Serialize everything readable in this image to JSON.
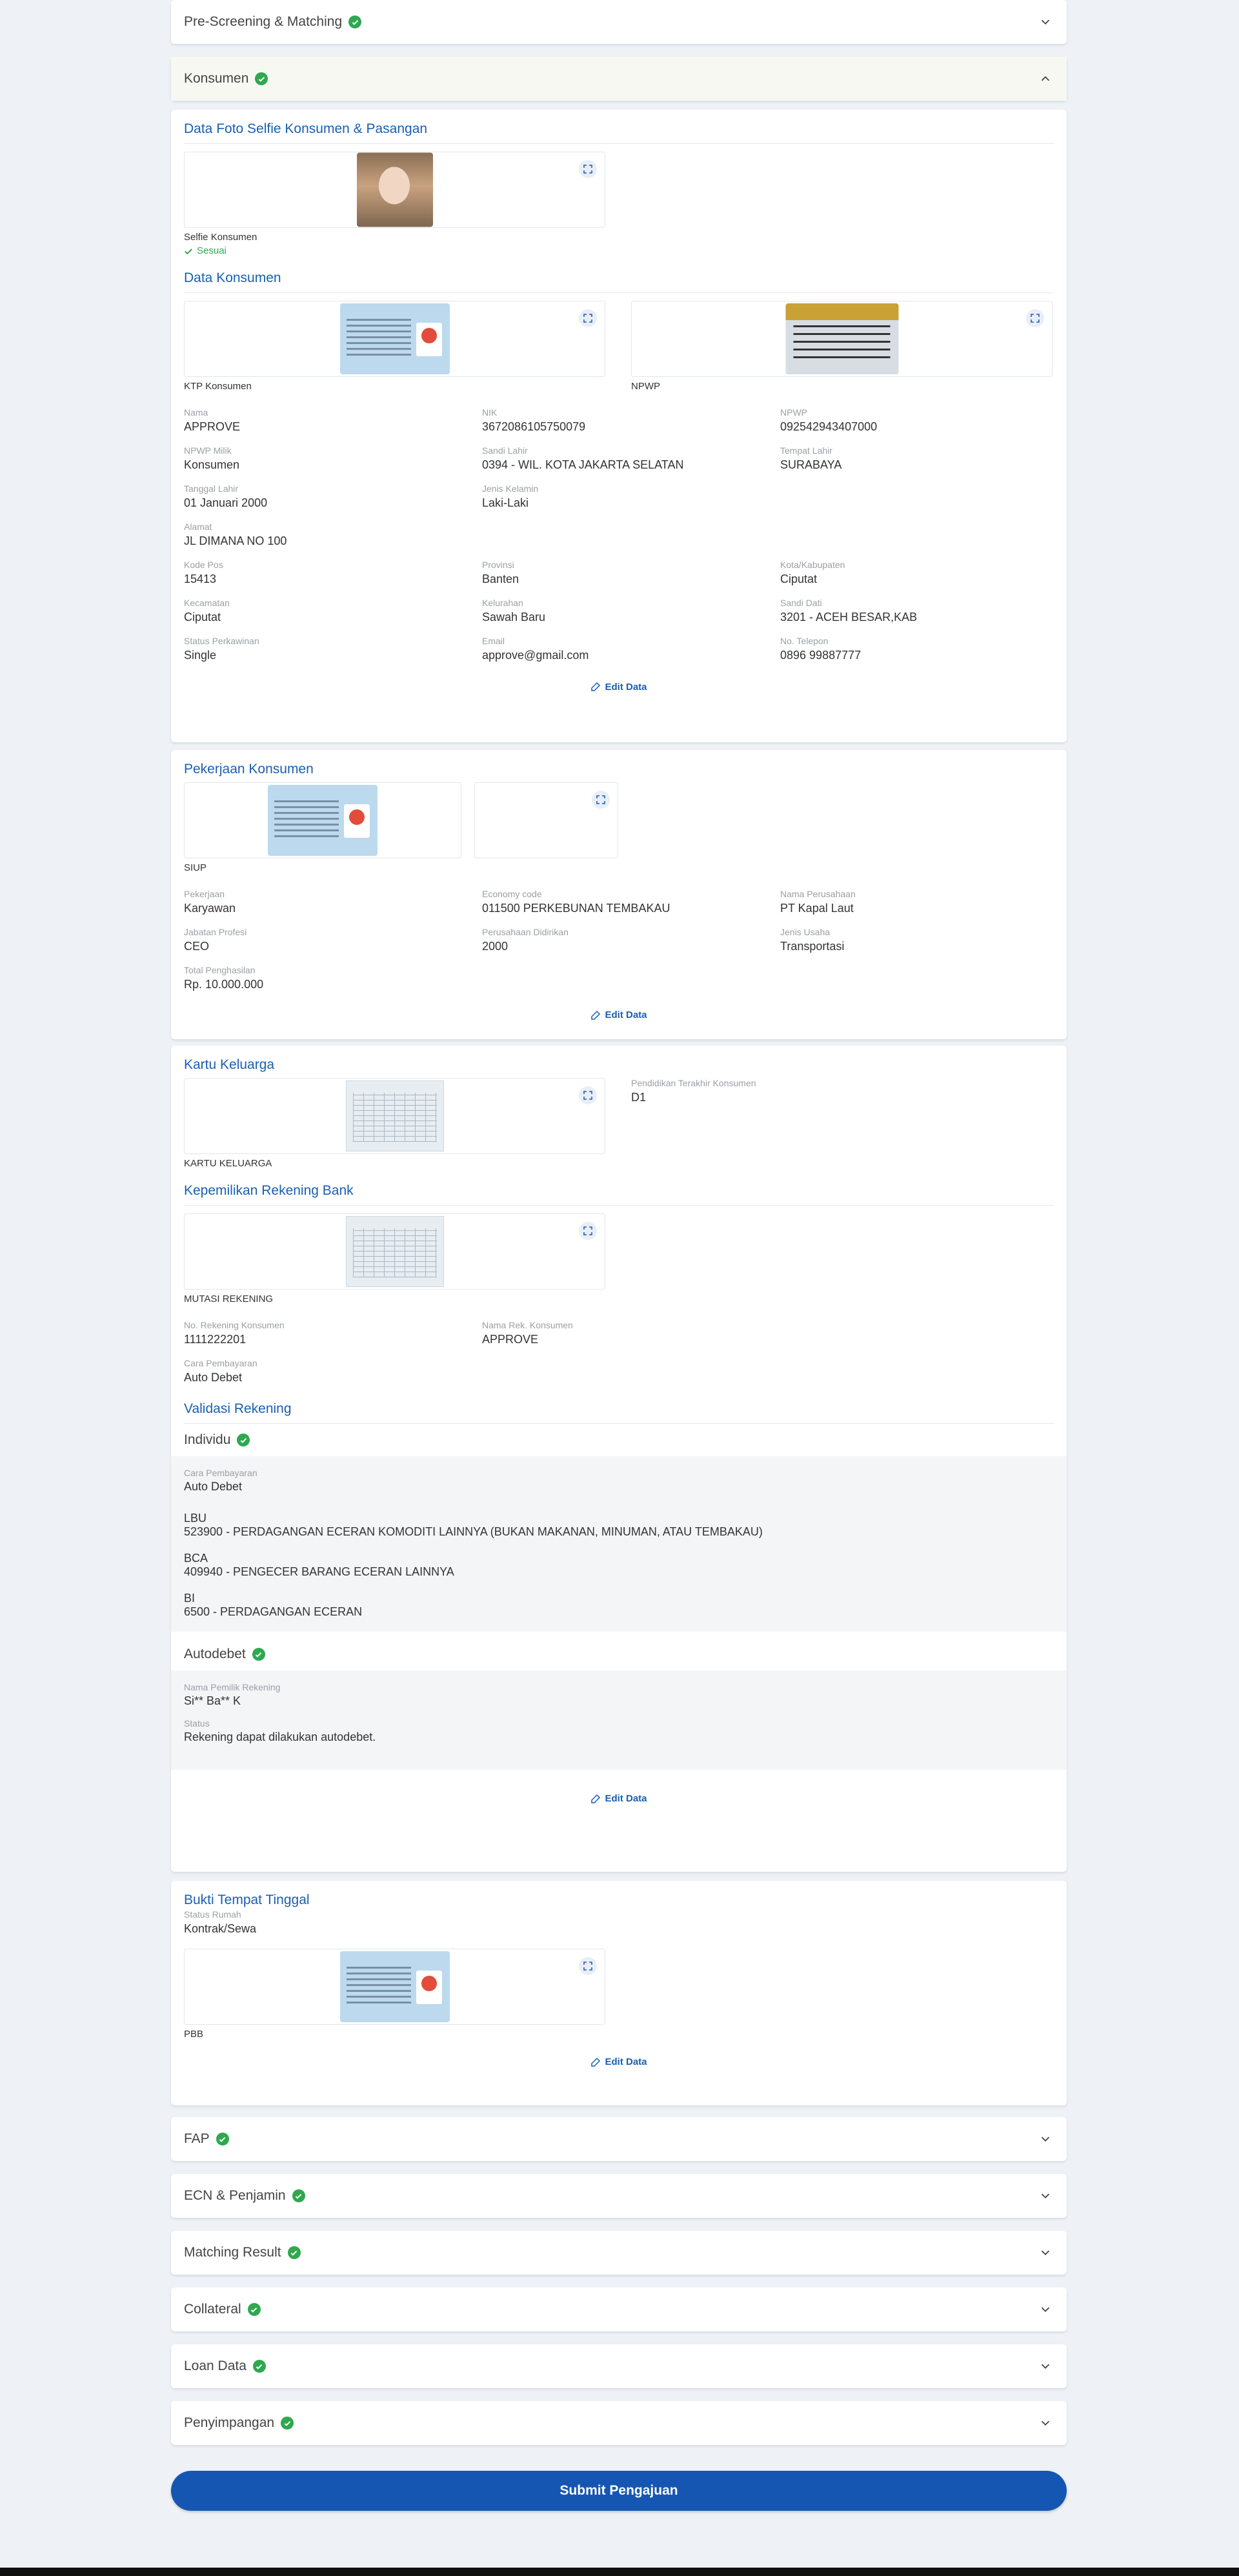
{
  "sections": {
    "prescreening": "Pre-Screening & Matching",
    "konsumen": "Konsumen",
    "fap": "FAP",
    "ecn": "ECN & Penjamin",
    "matching": "Matching Result",
    "collateral": "Collateral",
    "loan": "Loan Data",
    "penyimpangan": "Penyimpangan"
  },
  "selfie": {
    "title": "Data Foto Selfie Konsumen & Pasangan",
    "label": "Selfie Konsumen",
    "status": "Sesuai"
  },
  "data_konsumen": {
    "title": "Data Konsumen",
    "ktp_label": "KTP Konsumen",
    "npwp_label": "NPWP",
    "fields": [
      {
        "label": "Nama",
        "value": "APPROVE"
      },
      {
        "label": "NIK",
        "value": "3672086105750079"
      },
      {
        "label": "NPWP",
        "value": "092542943407000"
      },
      {
        "label": "NPWP Milik",
        "value": "Konsumen"
      },
      {
        "label": "Sandi Lahir",
        "value": "0394 - WIL. KOTA JAKARTA SELATAN"
      },
      {
        "label": "Tempat Lahir",
        "value": "SURABAYA"
      },
      {
        "label": "Tanggal Lahir",
        "value": "01 Januari 2000"
      },
      {
        "label": "Jenis Kelamin",
        "value": "Laki-Laki"
      },
      {
        "label": "Alamat",
        "value": "JL DIMANA NO 100"
      },
      {
        "label": "Kode Pos",
        "value": "15413"
      },
      {
        "label": "Provinsi",
        "value": "Banten"
      },
      {
        "label": "Kota/Kabupaten",
        "value": "Ciputat"
      },
      {
        "label": "Kecamatan",
        "value": "Ciputat"
      },
      {
        "label": "Kelurahan",
        "value": "Sawah Baru"
      },
      {
        "label": "Sandi Dati",
        "value": "3201 - ACEH BESAR,KAB"
      },
      {
        "label": "Status Perkawinan",
        "value": "Single"
      },
      {
        "label": "Email",
        "value": "approve@gmail.com"
      },
      {
        "label": "No. Telepon",
        "value": "0896 99887777"
      }
    ]
  },
  "edit_label": "Edit Data",
  "pekerjaan": {
    "title": "Pekerjaan Konsumen",
    "siup_label": "SIUP",
    "fields": [
      {
        "label": "Pekerjaan",
        "value": "Karyawan"
      },
      {
        "label": "Economy code",
        "value": "011500 PERKEBUNAN TEMBAKAU"
      },
      {
        "label": "Nama Perusahaan",
        "value": "PT Kapal Laut"
      },
      {
        "label": "Jabatan Profesi",
        "value": "CEO"
      },
      {
        "label": "Perusahaan Didirikan",
        "value": "2000"
      },
      {
        "label": "Jenis Usaha",
        "value": "Transportasi"
      },
      {
        "label": "Total Penghasilan",
        "value": "Rp. 10.000.000"
      }
    ]
  },
  "kartu_keluarga": {
    "title": "Kartu Keluarga",
    "img_label": "KARTU KELUARGA",
    "pendidikan_label": "Pendidikan Terakhir Konsumen",
    "pendidikan_value": "D1"
  },
  "rekening": {
    "title": "Kepemilikan Rekening Bank",
    "img_label": "MUTASI REKENING",
    "no_label": "No. Rekening Konsumen",
    "no_value": "1111222201",
    "nama_label": "Nama Rek. Konsumen",
    "nama_value": "APPROVE",
    "cara_label": "Cara Pembayaran",
    "cara_value": "Auto Debet"
  },
  "validasi": {
    "title": "Validasi Rekening",
    "individu": "Individu",
    "cara_label": "Cara Pembayaran",
    "cara_value": "Auto Debet",
    "lbu_label": "LBU",
    "lbu_value": "523900 - PERDAGANGAN ECERAN KOMODITI LAINNYA (BUKAN MAKANAN, MINUMAN, ATAU TEMBAKAU)",
    "bca_label": "BCA",
    "bca_value": "409940 - PENGECER BARANG ECERAN LAINNYA",
    "bi_label": "BI",
    "bi_value": "6500 - PERDAGANGAN ECERAN",
    "autodebet": "Autodebet",
    "pemilik_label": "Nama Pemilik Rekening",
    "pemilik_value": "Si** Ba** K",
    "status_label": "Status",
    "status_value": "Rekening dapat dilakukan autodebet."
  },
  "tempat_tinggal": {
    "title": "Bukti Tempat Tinggal",
    "status_label": "Status Rumah",
    "status_value": "Kontrak/Sewa",
    "img_label": "PBB"
  },
  "submit_label": "Submit Pengajuan",
  "colors": {
    "primary": "#1556b2",
    "success": "#2fa84f",
    "heading": "#1a5fb0"
  }
}
